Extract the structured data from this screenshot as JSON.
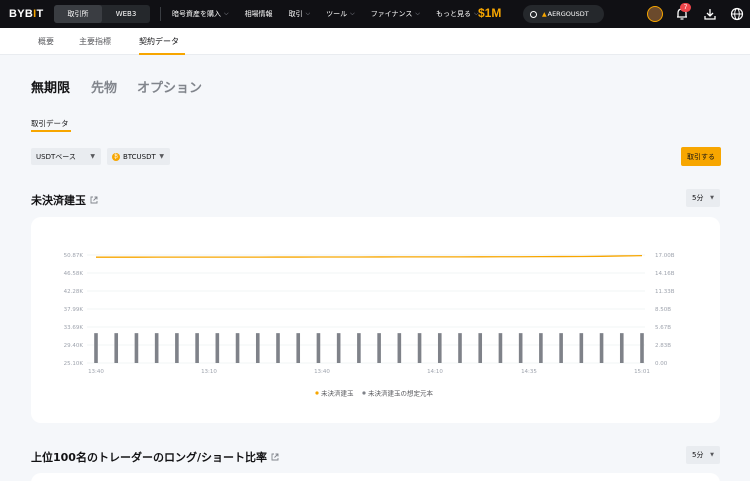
{
  "nav": {
    "logo_left": "BYB",
    "logo_mid": "I",
    "logo_right": "T",
    "switch": [
      "取引所",
      "WEB3"
    ],
    "menu": [
      {
        "label": "暗号資産を購入",
        "chevron": true
      },
      {
        "label": "相場情報",
        "chevron": false
      },
      {
        "label": "取引",
        "chevron": true
      },
      {
        "label": "ツール",
        "chevron": true
      },
      {
        "label": "ファイナンス",
        "chevron": true
      },
      {
        "label": "もっと見る",
        "chevron": true
      }
    ],
    "promo": "$1M",
    "search_value": "AERGOUSDT",
    "notification_count": "7"
  },
  "subnav": {
    "tabs": [
      "概要",
      "主要指標",
      "契約データ"
    ],
    "active_tab": "契約データ"
  },
  "categories": [
    "無期限",
    "先物",
    "オプション"
  ],
  "section_tab": "取引データ",
  "filters": {
    "base": "USDTベース",
    "symbol": "BTCUSDT",
    "coin_glyph": "₿",
    "trade_button": "取引する"
  },
  "open_interest": {
    "title": "未決済建玉",
    "period": "5分"
  },
  "long_short": {
    "title": "上位100名のトレーダーのロング/ショート比率",
    "period": "5分"
  },
  "colors": {
    "accent": "#f7a600",
    "bar": "#7f8289",
    "dark": "#101014"
  },
  "chart_data": {
    "type": "bar",
    "title": "未決済建玉",
    "x_ticks": [
      "13:40",
      "13:10",
      "13:40",
      "14:10",
      "14:35",
      "15:01"
    ],
    "left_axis": {
      "ticks": [
        "25.10K",
        "29.40K",
        "33.69K",
        "37.99K",
        "42.28K",
        "46.58K",
        "50.87K"
      ],
      "range": [
        25.1,
        50.87
      ]
    },
    "right_axis": {
      "ticks": [
        "0.00",
        "2.83B",
        "5.67B",
        "8.50B",
        "11.33B",
        "14.16B",
        "17.00B"
      ],
      "range": [
        0,
        17.0
      ]
    },
    "series": [
      {
        "name": "未決済建玉",
        "type": "line",
        "axis": "left",
        "values": [
          50.35,
          50.35,
          50.35,
          50.36,
          50.36,
          50.36,
          50.36,
          50.37,
          50.37,
          50.38,
          50.38,
          50.39,
          50.4,
          50.4,
          50.41,
          50.42,
          50.42,
          50.43,
          50.43,
          50.44,
          50.45,
          50.46,
          50.48,
          50.5,
          50.52,
          50.56,
          50.65,
          50.72
        ]
      },
      {
        "name": "未決済建玉の想定元本",
        "type": "bar",
        "axis": "right",
        "values": [
          4.7,
          4.7,
          4.7,
          4.7,
          4.7,
          4.7,
          4.7,
          4.7,
          4.7,
          4.7,
          4.7,
          4.7,
          4.7,
          4.7,
          4.7,
          4.7,
          4.7,
          4.7,
          4.7,
          4.7,
          4.7,
          4.7,
          4.7,
          4.7,
          4.7,
          4.7,
          4.7,
          4.7
        ]
      }
    ]
  }
}
